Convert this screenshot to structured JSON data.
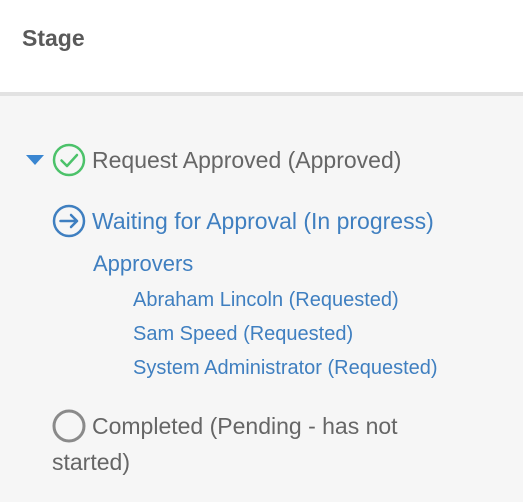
{
  "header": {
    "title": "Stage"
  },
  "stages": [
    {
      "label": "Request Approved (Approved)",
      "icon": "check-circle-icon",
      "status_color": "#4cc26a",
      "expanded": true
    },
    {
      "label": "Waiting for Approval (In progress)",
      "icon": "arrow-right-circle-icon",
      "status_color": "#3f7fc0",
      "approvers_title": "Approvers",
      "approvers": [
        "Abraham Lincoln (Requested)",
        "Sam Speed (Requested)",
        "System Administrator (Requested)"
      ]
    },
    {
      "label_line1": "Completed (Pending - has not",
      "label_line2": "started)",
      "icon": "empty-circle-icon",
      "status_color": "#8a8a8a"
    }
  ]
}
